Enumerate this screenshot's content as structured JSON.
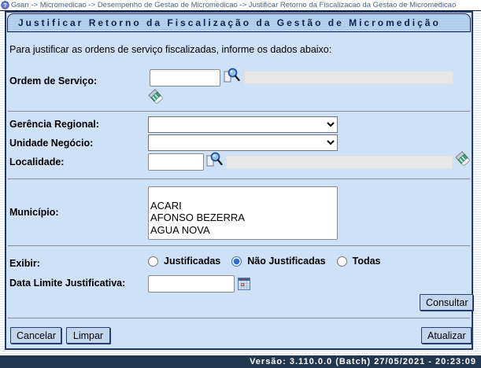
{
  "breadcrumb": {
    "text": "Gsan -> Micromedicao -> Desempenho de Gestao de Micromedicao -> Justificar Retorno da Fiscalizacao da Gestao de Micromedicao"
  },
  "header": {
    "title": "Justificar Retorno da Fiscalização da Gestão de Micromedição"
  },
  "intro": "Para justificar as ordens de serviço fiscalizadas, informe os dados abaixo:",
  "form": {
    "ordem_servico": {
      "label": "Ordem de Serviço:",
      "value": "",
      "readonly_value": ""
    },
    "gerencia_regional": {
      "label": "Gerência Regional:",
      "selected": ""
    },
    "unidade_negocio": {
      "label": "Unidade Negócio:",
      "selected": ""
    },
    "localidade": {
      "label": "Localidade:",
      "value": "",
      "readonly_value": ""
    },
    "municipio": {
      "label": "Município:",
      "options": [
        "",
        "ACARI",
        "AFONSO BEZERRA",
        "AGUA NOVA"
      ]
    },
    "exibir": {
      "label": "Exibir:",
      "options": [
        {
          "label": "Justificadas",
          "selected": false
        },
        {
          "label": "Não Justificadas",
          "selected": true
        },
        {
          "label": "Todas",
          "selected": false
        }
      ]
    },
    "data_limite": {
      "label": "Data Limite Justificativa:",
      "value": ""
    }
  },
  "buttons": {
    "consultar": "Consultar",
    "cancelar": "Cancelar",
    "limpar": "Limpar",
    "atualizar": "Atualizar"
  },
  "footer": {
    "version_text": "Versão: 3.110.0.0 (Batch) 27/05/2021 - 20:23:09"
  },
  "icons": [
    "help-icon",
    "search-icon",
    "eraser-icon",
    "calendar-icon"
  ],
  "colors": {
    "frame_border": "#24386b",
    "frame_background": "#cfe1f6",
    "titlebar_blue": "#9cc0ea",
    "button_background": "#c4d6ee",
    "footer_background": "#22374d",
    "radio_accent": "#2e6cd3"
  }
}
